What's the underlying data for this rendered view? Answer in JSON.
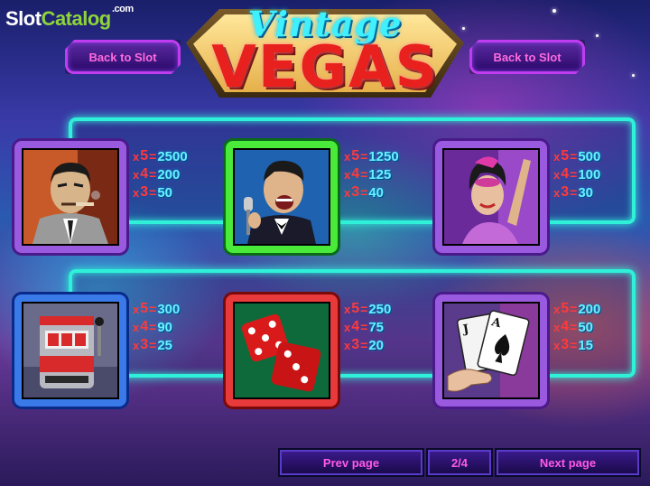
{
  "brand": {
    "part1": "Slot",
    "part2": "Catalog",
    "suffix": ".com"
  },
  "title": {
    "line1": "Vintage",
    "line2": "VEGAS"
  },
  "buttons": {
    "back_left": "Back to Slot",
    "back_right": "Back to Slot"
  },
  "symbols": [
    {
      "name": "mobster",
      "pays": [
        {
          "count": "5",
          "value": "2500"
        },
        {
          "count": "4",
          "value": "200"
        },
        {
          "count": "3",
          "value": "50"
        }
      ]
    },
    {
      "name": "singer",
      "pays": [
        {
          "count": "5",
          "value": "1250"
        },
        {
          "count": "4",
          "value": "125"
        },
        {
          "count": "3",
          "value": "40"
        }
      ]
    },
    {
      "name": "showgirl",
      "pays": [
        {
          "count": "5",
          "value": "500"
        },
        {
          "count": "4",
          "value": "100"
        },
        {
          "count": "3",
          "value": "30"
        }
      ]
    },
    {
      "name": "slot-machine",
      "pays": [
        {
          "count": "5",
          "value": "300"
        },
        {
          "count": "4",
          "value": "90"
        },
        {
          "count": "3",
          "value": "25"
        }
      ]
    },
    {
      "name": "dice",
      "pays": [
        {
          "count": "5",
          "value": "250"
        },
        {
          "count": "4",
          "value": "75"
        },
        {
          "count": "3",
          "value": "20"
        }
      ]
    },
    {
      "name": "cards",
      "pays": [
        {
          "count": "5",
          "value": "200"
        },
        {
          "count": "4",
          "value": "50"
        },
        {
          "count": "3",
          "value": "15"
        }
      ]
    }
  ],
  "cards_text": {
    "jack": "J",
    "ace": "A"
  },
  "nav": {
    "prev": "Prev page",
    "page": "2/4",
    "next": "Next page"
  },
  "glyphs": {
    "multiplier": "x",
    "equals": "="
  },
  "colors": {
    "neon_rail": "#2ff0d8",
    "pay_value": "#6af0ff",
    "pay_multiplier": "#ff3a3a",
    "button_text": "#ff5ae8"
  }
}
